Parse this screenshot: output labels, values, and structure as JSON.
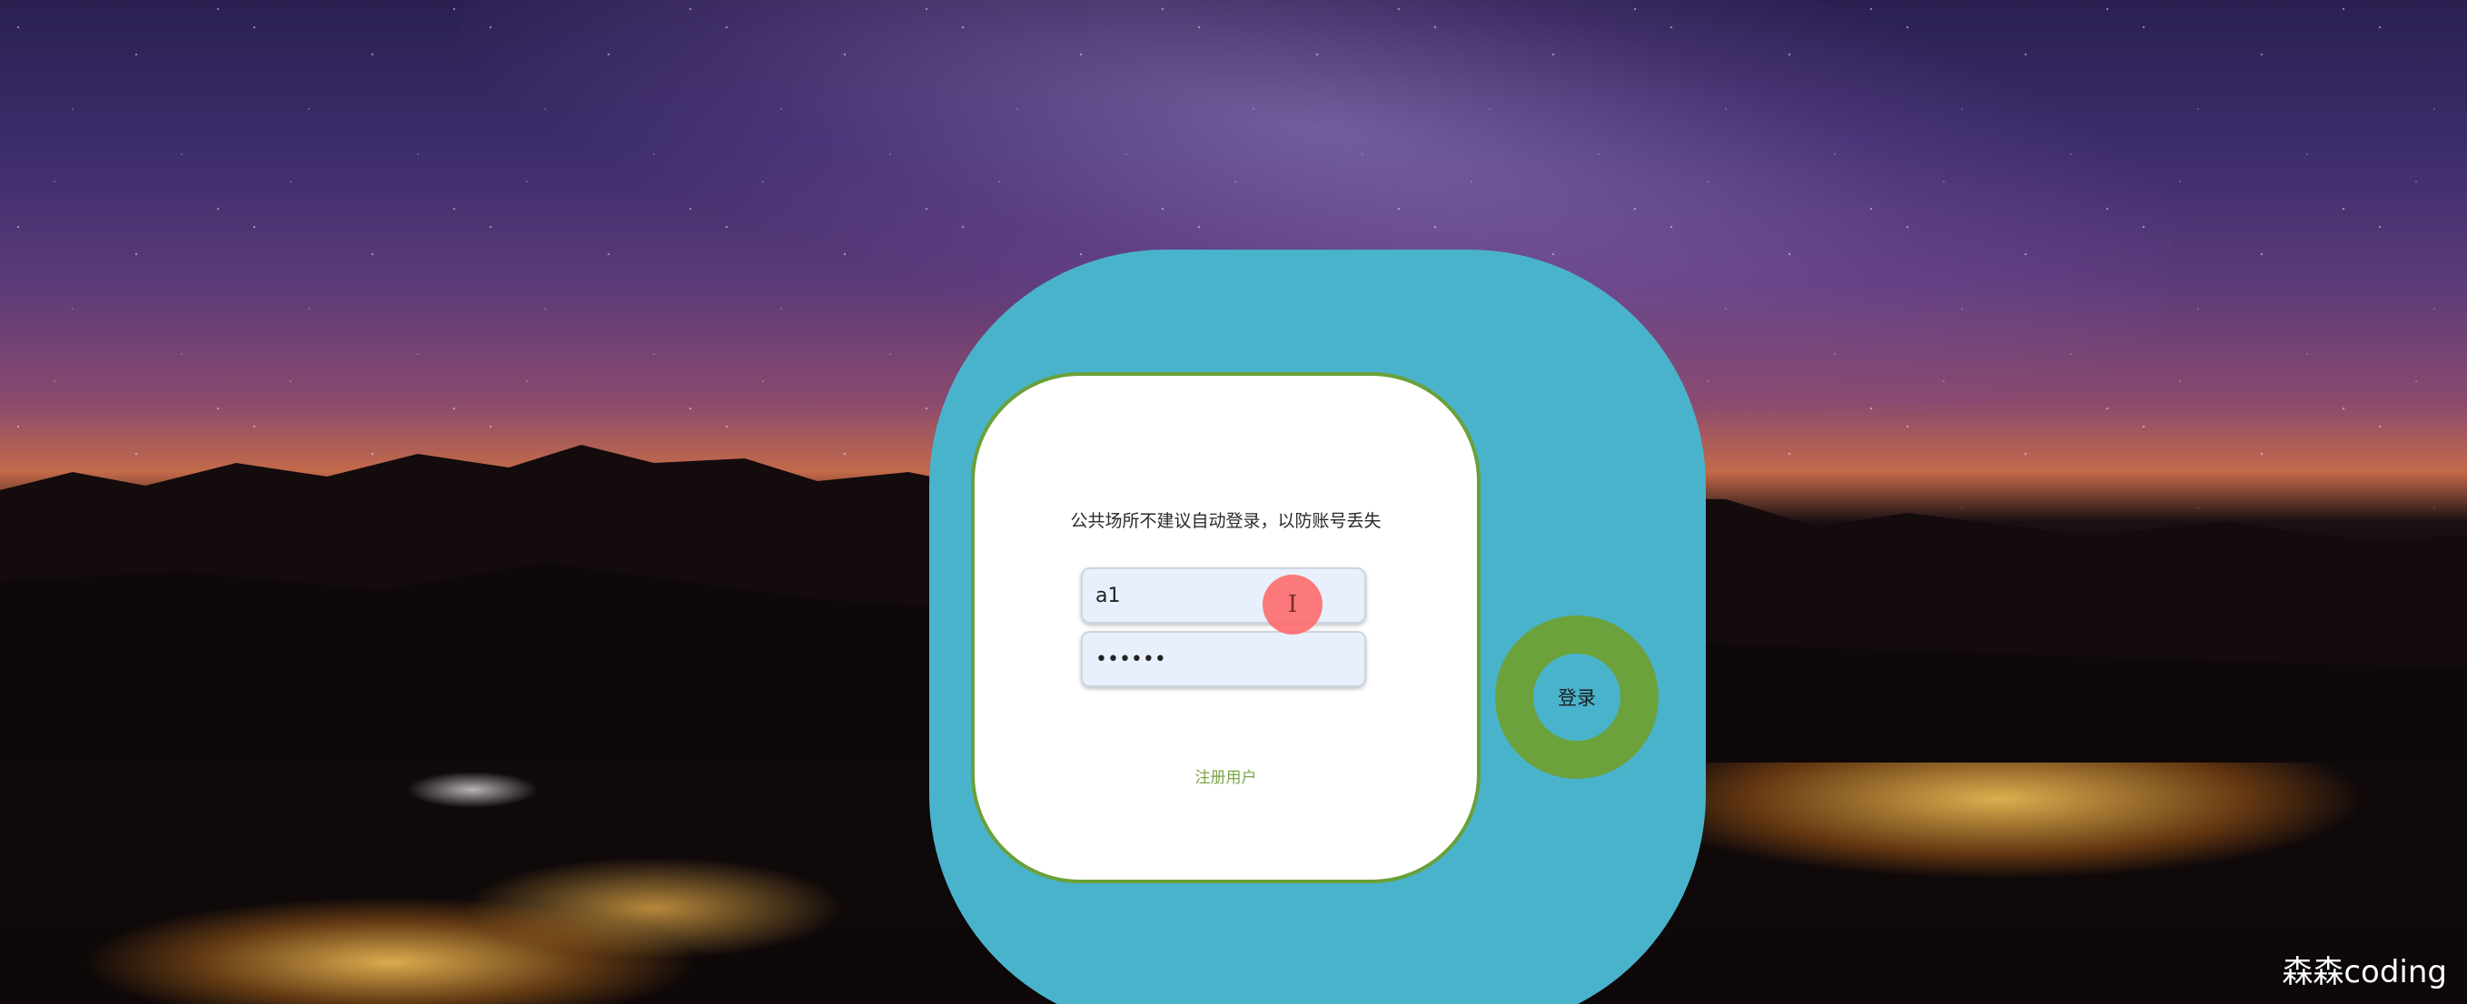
{
  "login": {
    "notice": "公共场所不建议自动登录，以防账号丢失",
    "username_value": "a1",
    "password_value": "••••••",
    "register_link": "注册用户",
    "login_button": "登录"
  },
  "watermark": "森森coding",
  "colors": {
    "card_blue": "#4ab3cc",
    "accent_green": "#6ba23c",
    "input_bg": "#e8f0fd",
    "cursor_marker": "#ff6464"
  },
  "icons": {
    "cursor": "text-cursor-icon"
  }
}
